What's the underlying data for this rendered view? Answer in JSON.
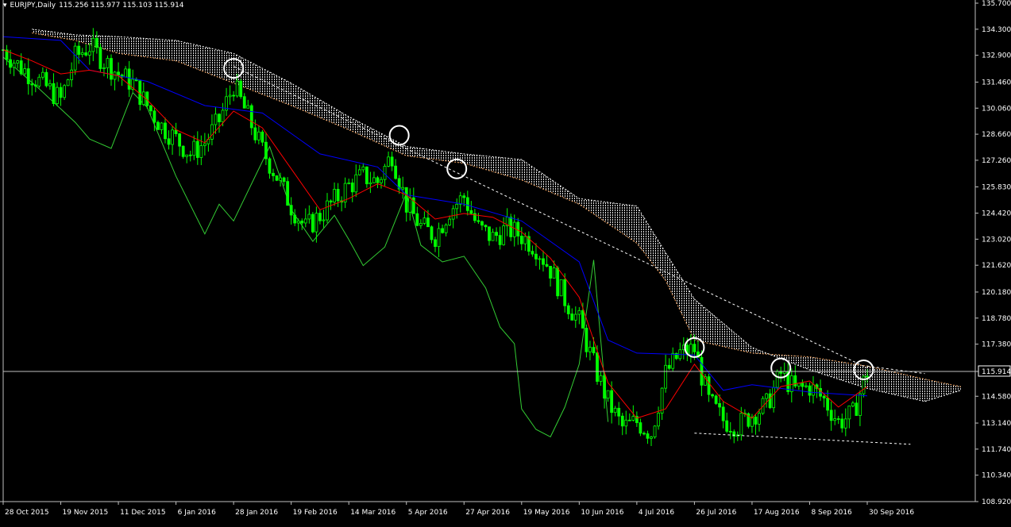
{
  "header": {
    "symbol_label": "EURJPY,Daily",
    "ohlc": "115.256 115.977 115.103 115.914"
  },
  "colors": {
    "background": "#000000",
    "axis": "#c0c0c0",
    "grid_text": "#ffffff",
    "candle_bull": "#00ff00",
    "candle_bear": "#00ff00",
    "tenkan": "#ff0000",
    "kijun": "#0000ff",
    "chikou": "#33cc33",
    "cloud": "#ffffff",
    "cloud_bear_edge": "#f4a460",
    "trendline": "#ffffff",
    "current_price_line": "#c0c0c0",
    "price_box": "#000000"
  },
  "chart_data": {
    "type": "candlestick",
    "title": "EURJPY,Daily",
    "ylim": [
      108.92,
      135.7
    ],
    "current_price": 115.914,
    "y_ticks": [
      "135.700",
      "134.300",
      "132.900",
      "131.460",
      "130.060",
      "128.660",
      "127.260",
      "125.830",
      "124.420",
      "123.020",
      "121.620",
      "120.180",
      "118.780",
      "117.380",
      "115.914",
      "114.580",
      "113.140",
      "111.740",
      "110.340",
      "108.920"
    ],
    "x_ticks": [
      "28 Oct 2015",
      "19 Nov 2015",
      "11 Dec 2015",
      "6 Jan 2016",
      "28 Jan 2016",
      "19 Feb 2016",
      "14 Mar 2016",
      "5 Apr 2016",
      "27 Apr 2016",
      "19 May 2016",
      "10 Jun 2016",
      "4 Jul 2016",
      "26 Jul 2016",
      "17 Aug 2016",
      "8 Sep 2016",
      "30 Sep 2016"
    ],
    "x_tick_index": [
      0,
      16,
      32,
      48,
      64,
      80,
      96,
      112,
      128,
      144,
      160,
      176,
      192,
      208,
      224,
      240
    ],
    "price_path": [
      [
        0,
        133.2
      ],
      [
        4,
        132.4
      ],
      [
        8,
        131.8
      ],
      [
        12,
        131.2
      ],
      [
        16,
        130.5
      ],
      [
        20,
        132.8
      ],
      [
        24,
        133.4
      ],
      [
        28,
        132.6
      ],
      [
        32,
        131.9
      ],
      [
        36,
        131.4
      ],
      [
        40,
        130.2
      ],
      [
        44,
        129.1
      ],
      [
        48,
        128.4
      ],
      [
        52,
        127.6
      ],
      [
        56,
        128.2
      ],
      [
        60,
        129.4
      ],
      [
        64,
        131.3
      ],
      [
        68,
        129.6
      ],
      [
        72,
        127.8
      ],
      [
        76,
        126.4
      ],
      [
        80,
        124.8
      ],
      [
        84,
        123.6
      ],
      [
        88,
        124.3
      ],
      [
        92,
        125.1
      ],
      [
        96,
        125.9
      ],
      [
        100,
        126.4
      ],
      [
        104,
        126.1
      ],
      [
        108,
        127.6
      ],
      [
        112,
        124.9
      ],
      [
        116,
        123.7
      ],
      [
        120,
        123.2
      ],
      [
        124,
        124.6
      ],
      [
        128,
        125.3
      ],
      [
        132,
        123.6
      ],
      [
        136,
        123.1
      ],
      [
        140,
        123.6
      ],
      [
        144,
        123.2
      ],
      [
        148,
        122.6
      ],
      [
        152,
        121.4
      ],
      [
        156,
        119.8
      ],
      [
        160,
        118.6
      ],
      [
        164,
        116.3
      ],
      [
        168,
        114.3
      ],
      [
        172,
        112.9
      ],
      [
        176,
        113.2
      ],
      [
        180,
        112.6
      ],
      [
        184,
        115.8
      ],
      [
        188,
        116.9
      ],
      [
        192,
        117.1
      ],
      [
        196,
        114.3
      ],
      [
        200,
        113.3
      ],
      [
        204,
        113.0
      ],
      [
        208,
        113.6
      ],
      [
        212,
        114.1
      ],
      [
        216,
        115.8
      ],
      [
        220,
        114.9
      ],
      [
        224,
        115.1
      ],
      [
        228,
        114.4
      ],
      [
        232,
        113.2
      ],
      [
        236,
        113.6
      ],
      [
        240,
        115.9
      ]
    ],
    "tenkan_path": [
      [
        0,
        133.2
      ],
      [
        8,
        132.6
      ],
      [
        16,
        131.9
      ],
      [
        24,
        132.1
      ],
      [
        32,
        131.8
      ],
      [
        40,
        130.5
      ],
      [
        48,
        128.9
      ],
      [
        56,
        128.2
      ],
      [
        64,
        129.9
      ],
      [
        72,
        129.0
      ],
      [
        80,
        126.8
      ],
      [
        88,
        124.6
      ],
      [
        96,
        125.2
      ],
      [
        104,
        126.0
      ],
      [
        112,
        125.4
      ],
      [
        120,
        124.1
      ],
      [
        128,
        124.4
      ],
      [
        136,
        124.2
      ],
      [
        144,
        123.4
      ],
      [
        152,
        122.0
      ],
      [
        160,
        119.9
      ],
      [
        168,
        115.3
      ],
      [
        176,
        113.4
      ],
      [
        184,
        113.9
      ],
      [
        192,
        116.3
      ],
      [
        200,
        114.3
      ],
      [
        208,
        113.4
      ],
      [
        216,
        115.1
      ],
      [
        224,
        115.4
      ],
      [
        232,
        114.0
      ],
      [
        240,
        115.1
      ]
    ],
    "kijun_path": [
      [
        0,
        133.9
      ],
      [
        16,
        133.7
      ],
      [
        24,
        132.1
      ],
      [
        40,
        131.5
      ],
      [
        56,
        130.2
      ],
      [
        72,
        129.8
      ],
      [
        88,
        127.6
      ],
      [
        104,
        126.9
      ],
      [
        112,
        125.4
      ],
      [
        128,
        124.9
      ],
      [
        144,
        124.0
      ],
      [
        160,
        121.8
      ],
      [
        168,
        117.6
      ],
      [
        176,
        116.9
      ],
      [
        192,
        116.8
      ],
      [
        200,
        114.9
      ],
      [
        208,
        115.2
      ],
      [
        216,
        115.0
      ],
      [
        224,
        114.8
      ],
      [
        240,
        114.6
      ]
    ],
    "chikou_path": [
      [
        0,
        132.8
      ],
      [
        10,
        131.1
      ],
      [
        20,
        129.3
      ],
      [
        24,
        128.4
      ],
      [
        30,
        127.9
      ],
      [
        36,
        130.9
      ],
      [
        40,
        130.1
      ],
      [
        48,
        126.4
      ],
      [
        56,
        123.3
      ],
      [
        60,
        124.9
      ],
      [
        64,
        124.0
      ],
      [
        70,
        126.4
      ],
      [
        74,
        128.0
      ],
      [
        80,
        124.6
      ],
      [
        86,
        122.9
      ],
      [
        92,
        124.3
      ],
      [
        96,
        123.0
      ],
      [
        100,
        121.6
      ],
      [
        106,
        122.6
      ],
      [
        112,
        125.5
      ],
      [
        116,
        122.7
      ],
      [
        122,
        121.8
      ],
      [
        128,
        122.1
      ],
      [
        134,
        120.4
      ],
      [
        138,
        118.3
      ],
      [
        142,
        117.4
      ],
      [
        144,
        113.9
      ],
      [
        148,
        112.8
      ],
      [
        152,
        112.4
      ],
      [
        156,
        114.0
      ],
      [
        160,
        116.3
      ],
      [
        164,
        121.9
      ],
      [
        168,
        113.2
      ]
    ],
    "senkou_a_path": [
      [
        8,
        134.1
      ],
      [
        20,
        133.7
      ],
      [
        32,
        133.0
      ],
      [
        48,
        132.6
      ],
      [
        64,
        131.4
      ],
      [
        80,
        130.2
      ],
      [
        96,
        128.9
      ],
      [
        112,
        127.5
      ],
      [
        128,
        127.1
      ],
      [
        144,
        126.2
      ],
      [
        160,
        124.9
      ],
      [
        176,
        122.8
      ],
      [
        184,
        120.8
      ],
      [
        192,
        117.6
      ],
      [
        208,
        116.9
      ],
      [
        224,
        116.7
      ],
      [
        240,
        116.2
      ],
      [
        256,
        115.5
      ],
      [
        266,
        115.1
      ]
    ],
    "senkou_b_path": [
      [
        8,
        134.3
      ],
      [
        20,
        134.0
      ],
      [
        32,
        133.9
      ],
      [
        48,
        133.7
      ],
      [
        64,
        133.0
      ],
      [
        80,
        131.4
      ],
      [
        96,
        129.6
      ],
      [
        112,
        128.0
      ],
      [
        128,
        127.6
      ],
      [
        144,
        127.3
      ],
      [
        160,
        125.2
      ],
      [
        176,
        124.8
      ],
      [
        184,
        122.3
      ],
      [
        192,
        119.8
      ],
      [
        208,
        117.2
      ],
      [
        224,
        116.0
      ],
      [
        240,
        115.0
      ],
      [
        256,
        114.3
      ],
      [
        266,
        114.9
      ]
    ],
    "trendlines": [
      [
        [
          64,
          132.3
        ],
        [
          240,
          116.1
        ]
      ],
      [
        [
          192,
          112.6
        ],
        [
          252,
          112.0
        ]
      ],
      [
        [
          240,
          116.2
        ],
        [
          256,
          115.8
        ]
      ]
    ],
    "circles": [
      [
        64,
        132.2
      ],
      [
        110,
        128.6
      ],
      [
        126,
        126.8
      ],
      [
        192,
        117.2
      ],
      [
        216,
        116.1
      ],
      [
        239,
        116.0
      ]
    ]
  }
}
